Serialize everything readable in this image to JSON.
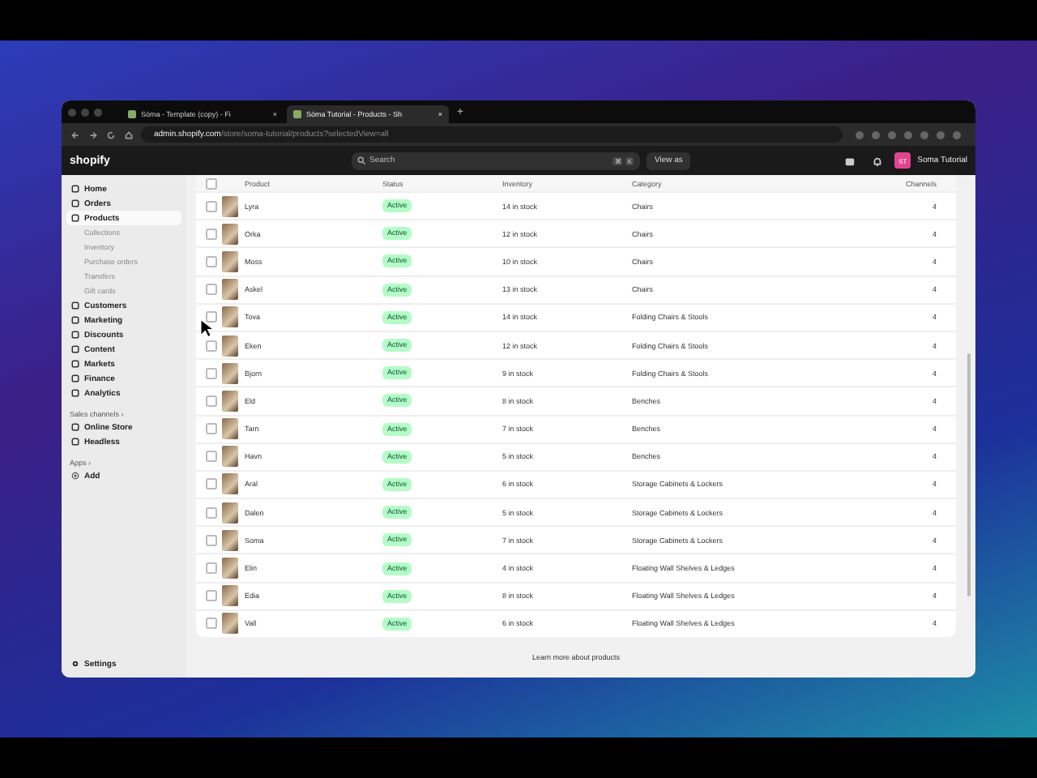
{
  "browser": {
    "tabs": [
      {
        "title": "Sóma - Template (copy) - Fi",
        "close": "×",
        "selected": false
      },
      {
        "title": "Sóma Tutorial - Products - Sh",
        "close": "×",
        "selected": true
      }
    ],
    "new_tab": "+",
    "url": "**admin.shopify.com**/store/soma-tutorial/products?selectedView=all"
  },
  "header": {
    "logo": "shopify",
    "search": {
      "placeholder": "Search"
    },
    "shortcut": [
      "⌘",
      "K"
    ],
    "view_as": "View as",
    "avatar": "ST",
    "store": "Soma Tutorial"
  },
  "sidebar": {
    "items": [
      {
        "label": "Home",
        "selected": false
      },
      {
        "label": "Orders",
        "selected": false
      },
      {
        "label": "Products",
        "selected": true,
        "children": [
          {
            "label": "Collections"
          },
          {
            "label": "Inventory"
          },
          {
            "label": "Purchase orders"
          },
          {
            "label": "Transfers"
          },
          {
            "label": "Gift cards"
          }
        ]
      },
      {
        "label": "Customers",
        "selected": false
      },
      {
        "label": "Marketing",
        "selected": false
      },
      {
        "label": "Discounts",
        "selected": false
      },
      {
        "label": "Content",
        "selected": false
      },
      {
        "label": "Markets",
        "selected": false
      },
      {
        "label": "Finance",
        "selected": false
      },
      {
        "label": "Analytics",
        "selected": false
      }
    ],
    "sales_channels": {
      "heading": "Sales channels ›",
      "items": [
        {
          "label": "Online Store"
        },
        {
          "label": "Headless"
        }
      ]
    },
    "apps": {
      "heading": "Apps ›",
      "items": [
        {
          "label": "Add"
        }
      ]
    },
    "settings": "Settings"
  },
  "table": {
    "select_all_checked": false,
    "columns": [
      "Product",
      "Status",
      "Inventory",
      "Category",
      "Channels"
    ],
    "rows": [
      {
        "product": "Lyra",
        "status": "Active",
        "inventory": "14 in stock",
        "category": "Chairs",
        "channels": "4",
        "checked": false
      },
      {
        "product": "Orka",
        "status": "Active",
        "inventory": "12 in stock",
        "category": "Chairs",
        "channels": "4",
        "checked": false
      },
      {
        "product": "Moss",
        "status": "Active",
        "inventory": "10 in stock",
        "category": "Chairs",
        "channels": "4",
        "checked": false
      },
      {
        "product": "Askel",
        "status": "Active",
        "inventory": "13 in stock",
        "category": "Chairs",
        "channels": "4",
        "checked": false
      },
      {
        "product": "Tova",
        "status": "Active",
        "inventory": "14 in stock",
        "category": "Folding Chairs & Stools",
        "channels": "4",
        "checked": false
      },
      {
        "product": "Eken",
        "status": "Active",
        "inventory": "12 in stock",
        "category": "Folding Chairs & Stools",
        "channels": "4",
        "checked": false
      },
      {
        "product": "Bjorn",
        "status": "Active",
        "inventory": "9 in stock",
        "category": "Folding Chairs & Stools",
        "channels": "4",
        "checked": false
      },
      {
        "product": "Eld",
        "status": "Active",
        "inventory": "8 in stock",
        "category": "Benches",
        "channels": "4",
        "checked": false
      },
      {
        "product": "Tarn",
        "status": "Active",
        "inventory": "7 in stock",
        "category": "Benches",
        "channels": "4",
        "checked": false
      },
      {
        "product": "Havn",
        "status": "Active",
        "inventory": "5 in stock",
        "category": "Benches",
        "channels": "4",
        "checked": false
      },
      {
        "product": "Aral",
        "status": "Active",
        "inventory": "6 in stock",
        "category": "Storage Cabinets & Lockers",
        "channels": "4",
        "checked": false
      },
      {
        "product": "Dalen",
        "status": "Active",
        "inventory": "5 in stock",
        "category": "Storage Cabinets & Lockers",
        "channels": "4",
        "checked": false
      },
      {
        "product": "Soma",
        "status": "Active",
        "inventory": "7 in stock",
        "category": "Storage Cabinets & Lockers",
        "channels": "4",
        "checked": false
      },
      {
        "product": "Elin",
        "status": "Active",
        "inventory": "4 in stock",
        "category": "Floating Wall Shelves & Ledges",
        "channels": "4",
        "checked": false
      },
      {
        "product": "Edia",
        "status": "Active",
        "inventory": "8 in stock",
        "category": "Floating Wall Shelves & Ledges",
        "channels": "4",
        "checked": false
      },
      {
        "product": "Vall",
        "status": "Active",
        "inventory": "6 in stock",
        "category": "Floating Wall Shelves & Ledges",
        "channels": "4",
        "checked": false
      }
    ]
  },
  "footer_link": "Learn more about products"
}
